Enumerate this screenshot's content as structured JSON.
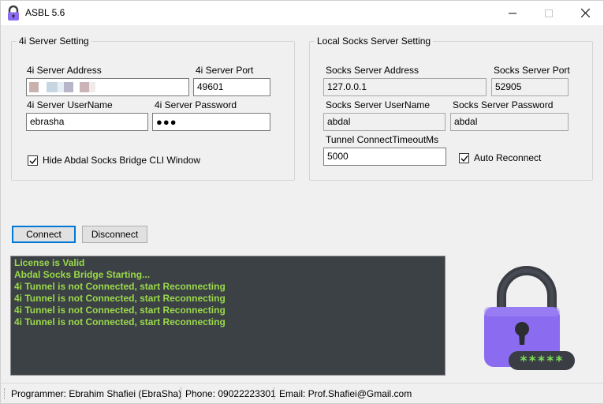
{
  "window": {
    "title": "ASBL 5.6"
  },
  "server_group": {
    "title": "4i Server Setting",
    "address_label": "4i Server Address",
    "address_value": "",
    "port_label": "4i Server Port",
    "port_value": "49601",
    "username_label": "4i Server UserName",
    "username_value": "ebrasha",
    "password_label": "4i Server Password",
    "password_value": "●●●",
    "hide_cli_label": "Hide Abdal Socks Bridge CLI Window",
    "hide_cli_checked": true
  },
  "socks_group": {
    "title": "Local Socks Server Setting",
    "address_label": "Socks Server Address",
    "address_value": "127.0.0.1",
    "port_label": "Socks Server Port",
    "port_value": "52905",
    "username_label": "Socks Server UserName",
    "username_value": "abdal",
    "password_label": "Socks Server Password",
    "password_value": "abdal",
    "timeout_label": "Tunnel ConnectTimeoutMs",
    "timeout_value": "5000",
    "auto_reconnect_label": "Auto Reconnect",
    "auto_reconnect_checked": true
  },
  "buttons": {
    "connect": "Connect",
    "disconnect": "Disconnect"
  },
  "log": {
    "lines": [
      "License is Valid",
      "Abdal Socks Bridge Starting...",
      "4i Tunnel is not Connected, start Reconnecting",
      "4i Tunnel is not Connected, start Reconnecting",
      "4i Tunnel is not Connected, start Reconnecting",
      "4i Tunnel is not Connected, start Reconnecting"
    ],
    "text_color": "#9ad94a",
    "background": "#3c4146"
  },
  "status": {
    "programmer": "Programmer: Ebrahim Shafiei (EbraSha)",
    "phone": "Phone: 09022223301",
    "email": "Email: Prof.Shafiei@Gmail.com"
  },
  "icons": {
    "app": "padlock-icon",
    "illustration": "padlock-password-icon",
    "password_mask": "*****"
  },
  "colors": {
    "accent": "#0078d7",
    "lock_body": "#8b6cf0",
    "lock_shackle": "#3a3d44"
  }
}
